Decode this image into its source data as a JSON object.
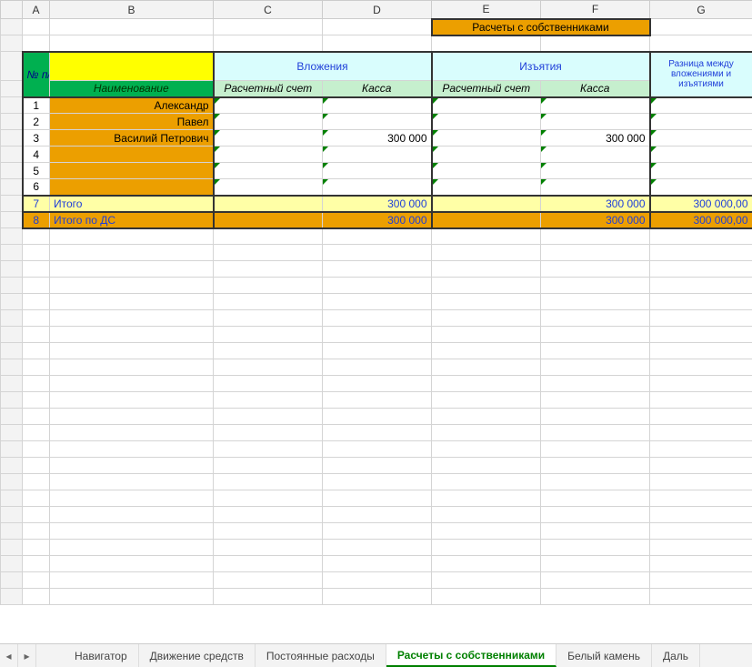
{
  "columns": [
    "A",
    "B",
    "C",
    "D",
    "E",
    "F",
    "G"
  ],
  "title_banner": "Расчеты с собственниками",
  "header": {
    "no_label": "№ п/п",
    "name_label": "Наименование",
    "deposits": "Вложения",
    "withdrawals": "Изъятия",
    "diff": "Разница между вложениями и изъятиями",
    "account": "Расчетный счет",
    "cash": "Касса"
  },
  "rows": [
    {
      "n": "1",
      "name": "Александр",
      "dep_acc": "",
      "dep_cash": "",
      "wd_acc": "",
      "wd_cash": "",
      "diff": ""
    },
    {
      "n": "2",
      "name": "Павел",
      "dep_acc": "",
      "dep_cash": "",
      "wd_acc": "",
      "wd_cash": "",
      "diff": ""
    },
    {
      "n": "3",
      "name": "Василий Петрович",
      "dep_acc": "",
      "dep_cash": "300 000",
      "wd_acc": "",
      "wd_cash": "300 000",
      "diff": ""
    },
    {
      "n": "4",
      "name": "",
      "dep_acc": "",
      "dep_cash": "",
      "wd_acc": "",
      "wd_cash": "",
      "diff": ""
    },
    {
      "n": "5",
      "name": "",
      "dep_acc": "",
      "dep_cash": "",
      "wd_acc": "",
      "wd_cash": "",
      "diff": ""
    },
    {
      "n": "6",
      "name": "",
      "dep_acc": "",
      "dep_cash": "",
      "wd_acc": "",
      "wd_cash": "",
      "diff": ""
    }
  ],
  "totals": {
    "row7_n": "7",
    "row7_label": "Итого",
    "row7_dep_acc": "",
    "row7_dep_cash": "300 000",
    "row7_wd_acc": "",
    "row7_wd_cash": "300 000",
    "row7_diff": "300 000,00",
    "row8_n": "8",
    "row8_label": "Итого по ДС",
    "row8_dep_acc": "",
    "row8_dep_cash": "300 000",
    "row8_wd_acc": "",
    "row8_wd_cash": "300 000",
    "row8_diff": "300 000,00"
  },
  "tabs": [
    "Навигатор",
    "Движение средств",
    "Постоянные расходы",
    "Расчеты с собственниками",
    "Белый камень",
    "Даль"
  ],
  "active_tab": 3,
  "chart_data": {
    "type": "table",
    "title": "Расчеты с собственниками",
    "columns": [
      "№ п/п",
      "Наименование",
      "Вложения / Расчетный счет",
      "Вложения / Касса",
      "Изъятия / Расчетный счет",
      "Изъятия / Касса",
      "Разница между вложениями и изъятиями"
    ],
    "rows": [
      [
        1,
        "Александр",
        null,
        null,
        null,
        null,
        null
      ],
      [
        2,
        "Павел",
        null,
        null,
        null,
        null,
        null
      ],
      [
        3,
        "Василий Петрович",
        null,
        300000,
        null,
        300000,
        null
      ],
      [
        4,
        "",
        null,
        null,
        null,
        null,
        null
      ],
      [
        5,
        "",
        null,
        null,
        null,
        null,
        null
      ],
      [
        6,
        "",
        null,
        null,
        null,
        null,
        null
      ],
      [
        7,
        "Итого",
        null,
        300000,
        null,
        300000,
        300000.0
      ],
      [
        8,
        "Итого по ДС",
        null,
        300000,
        null,
        300000,
        300000.0
      ]
    ]
  }
}
